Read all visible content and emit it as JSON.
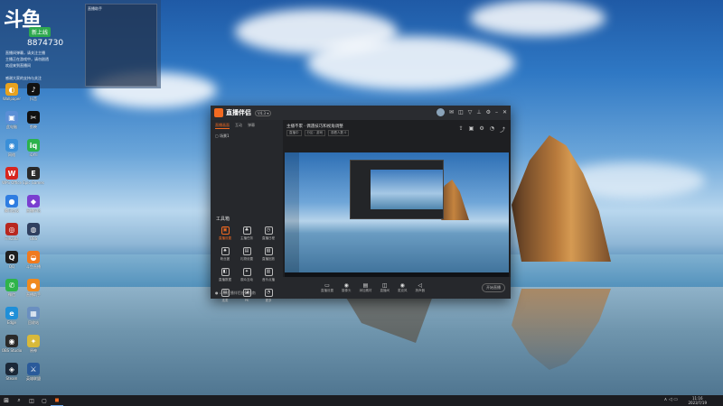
{
  "overlay": {
    "logo_text": "斗鱼",
    "tag": "新上线",
    "room_number": "8874730",
    "lines": [
      "直播间弹幕，请关注主播",
      "主播正在游戏中，请勿剧透",
      "欢迎来到直播间",
      "感谢大家的支持与关注"
    ],
    "panel_title": "直播助手"
  },
  "desktop_icons": [
    {
      "name": "app-icon-1",
      "label": "Wallpaper",
      "glyph": "◐",
      "color": "#e8a21e"
    },
    {
      "name": "tiktok-icon",
      "label": "抖音",
      "glyph": "♪",
      "color": "#111111"
    },
    {
      "name": "app-icon-3",
      "label": "此电脑",
      "glyph": "▣",
      "color": "#5b8fd6"
    },
    {
      "name": "capcut-icon",
      "label": "剪映",
      "glyph": "✂",
      "color": "#111111"
    },
    {
      "name": "app-icon-5",
      "label": "网络",
      "glyph": "◉",
      "color": "#3a8fd8"
    },
    {
      "name": "iqiyi-icon",
      "label": "iQIYI",
      "glyph": "iq",
      "color": "#2bb24c"
    },
    {
      "name": "wps-icon",
      "label": "WPS Office",
      "glyph": "W",
      "color": "#d7261f"
    },
    {
      "name": "epic-icon",
      "label": "Epic Games",
      "glyph": "E",
      "color": "#2a2a2a"
    },
    {
      "name": "app-icon-9",
      "label": "腾讯会议",
      "glyph": "●",
      "color": "#2f7de1"
    },
    {
      "name": "app-icon-10",
      "label": "直播伴侣",
      "glyph": "◆",
      "color": "#7a3fd0"
    },
    {
      "name": "app-icon-11",
      "label": "FileZilla",
      "glyph": "◎",
      "color": "#b8271f"
    },
    {
      "name": "app-icon-12",
      "label": "OBS",
      "glyph": "◍",
      "color": "#304060"
    },
    {
      "name": "qq-icon",
      "label": "QQ",
      "glyph": "Q",
      "color": "#1f1f1f"
    },
    {
      "name": "app-icon-14",
      "label": "斗鱼直播",
      "glyph": "◒",
      "color": "#f07a1f"
    },
    {
      "name": "wechat-icon",
      "label": "微信",
      "glyph": "✆",
      "color": "#2fb44a"
    },
    {
      "name": "app-icon-16",
      "label": "直播助手",
      "glyph": "●",
      "color": "#f08a1f"
    },
    {
      "name": "edge-icon",
      "label": "Edge",
      "glyph": "e",
      "color": "#1f8fd8"
    },
    {
      "name": "app-icon-18",
      "label": "回收站",
      "glyph": "▦",
      "color": "#6a8fc0"
    },
    {
      "name": "obs-icon",
      "label": "OBS Studio",
      "glyph": "◉",
      "color": "#2a2a2a"
    },
    {
      "name": "app-icon-20",
      "label": "原神",
      "glyph": "✦",
      "color": "#d8b93a"
    },
    {
      "name": "steam-icon",
      "label": "Steam",
      "glyph": "◈",
      "color": "#1b2838"
    },
    {
      "name": "app-icon-22",
      "label": "英雄联盟",
      "glyph": "⚔",
      "color": "#2a5a9a"
    }
  ],
  "app": {
    "name": "直播伴侣",
    "badge": "V4.3 ▾",
    "side_tabs": [
      "直播画面",
      "互动",
      "弹幕"
    ],
    "scene_label": "▢ 场景1",
    "tools_title": "工具箱",
    "tools": [
      {
        "glyph": "▣",
        "label": "直播设置",
        "hot": true
      },
      {
        "glyph": "♣",
        "label": "主播任务",
        "hot": false
      },
      {
        "glyph": "◷",
        "label": "直播日程",
        "hot": false
      },
      {
        "glyph": "♠",
        "label": "粉丝团",
        "hot": false
      },
      {
        "glyph": "▤",
        "label": "礼物设置",
        "hot": false
      },
      {
        "glyph": "▧",
        "label": "直播回放",
        "hot": false
      },
      {
        "glyph": "◧",
        "label": "直播数据",
        "hot": false
      },
      {
        "glyph": "✦",
        "label": "观众互动",
        "hot": false
      },
      {
        "glyph": "▥",
        "label": "音乐点播",
        "hot": false
      },
      {
        "glyph": "▤",
        "label": "连麦",
        "hot": false
      },
      {
        "glyph": "◪",
        "label": "PK",
        "hot": false
      },
      {
        "glyph": "◔",
        "label": "更多",
        "hot": false
      }
    ],
    "side_footer": "● 斗鱼直播伴侣使用指南",
    "room_title": "主播不累 · 偶遇技巧和视角调整",
    "room_tags": [
      "直播中",
      "分区：游戏",
      "观看人数 0"
    ],
    "toolbar": [
      {
        "glyph": "▭",
        "label": "直播设置"
      },
      {
        "glyph": "◉",
        "label": "摄像头"
      },
      {
        "glyph": "▤",
        "label": "添加素材"
      },
      {
        "glyph": "◫",
        "label": "直播间"
      },
      {
        "glyph": "◉",
        "label": "麦克风"
      },
      {
        "glyph": "◁",
        "label": "扬声器"
      }
    ],
    "go_live": "开始直播"
  },
  "taskbar": {
    "start_glyph": "⊞",
    "icons": [
      "⌕",
      "◫",
      "▢",
      "◼"
    ],
    "clock_time": "11:16",
    "clock_date": "2023/7/19",
    "tray": "∧ ◁ ▭"
  }
}
